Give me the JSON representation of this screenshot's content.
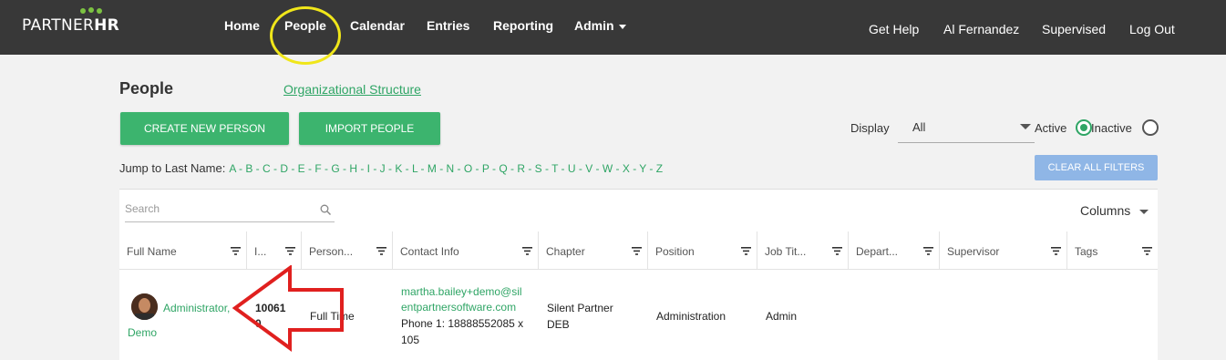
{
  "brand": {
    "logo_prefix": "PARTNER",
    "logo_suffix": "HR"
  },
  "nav": {
    "home": "Home",
    "people": "People",
    "calendar": "Calendar",
    "entries": "Entries",
    "reporting": "Reporting",
    "admin": "Admin",
    "get_help": "Get Help",
    "user_name": "Al Fernandez",
    "supervised": "Supervised",
    "log_out": "Log Out"
  },
  "page": {
    "title": "People",
    "org_link": "Organizational Structure",
    "create_button": "CREATE NEW PERSON",
    "import_button": "IMPORT PEOPLE",
    "display_label": "Display",
    "display_value": "All",
    "active_label": "Active",
    "inactive_label": "Inactive",
    "active_checked": true,
    "jump_label": "Jump to Last Name:",
    "jump_letters": "A - B - C - D - E - F - G - H - I - J - K - L - M - N - O - P - Q - R - S - T - U - V - W - X - Y - Z",
    "clear_filters": "CLEAR ALL FILTERS"
  },
  "table": {
    "search_placeholder": "Search",
    "columns_button": "Columns",
    "headers": [
      "Full Name",
      "I...",
      "Person...",
      "Contact Info",
      "Chapter",
      "Position",
      "Job Tit...",
      "Depart...",
      "Supervisor",
      "Tags"
    ],
    "rows": [
      {
        "name_line1": "Administrator,",
        "name_line2": "Demo",
        "id_line1": "10061",
        "id_line2": "0",
        "person_type": "Full Time",
        "email_line1": "martha.bailey+demo@sil",
        "email_line2": "entpartnersoftware.com",
        "phone_line1": "Phone 1: 18888552085 x",
        "phone_line2": "105",
        "chapter_line1": "Silent Partner",
        "chapter_line2": "DEB",
        "position": "Administration",
        "job_title": "Admin"
      }
    ]
  },
  "colors": {
    "accent_green": "#3cb46e",
    "nav_bg": "#383838",
    "highlight_yellow": "#f0e61a",
    "annotation_red": "#e0201f"
  }
}
